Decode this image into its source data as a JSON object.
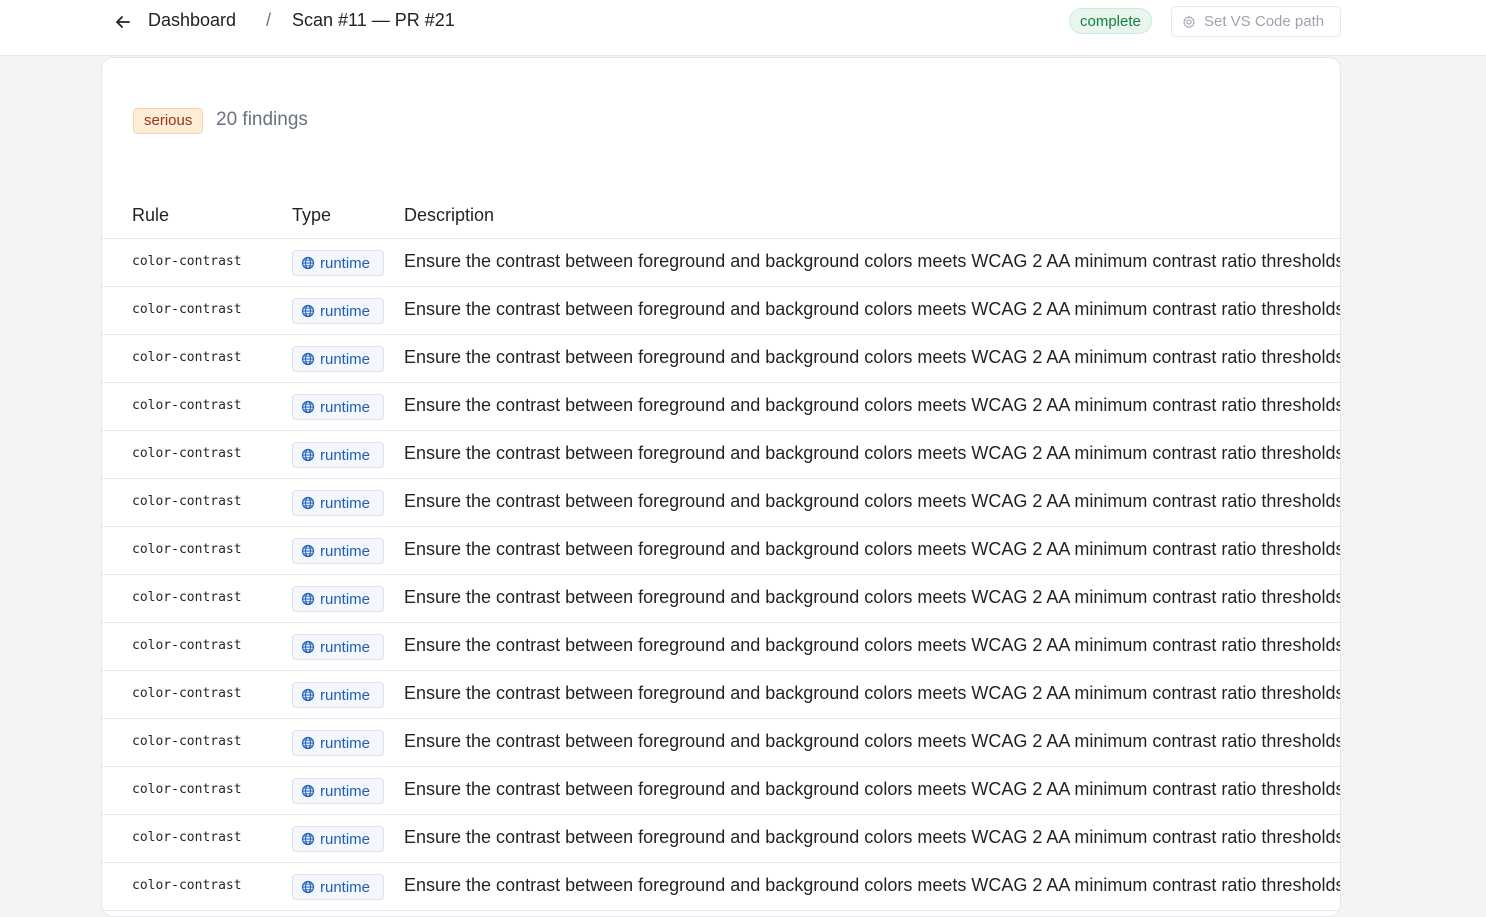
{
  "header": {
    "back_icon": "arrow-left-icon",
    "breadcrumb_root": "Dashboard",
    "breadcrumb_separator": "/",
    "breadcrumb_current": "Scan #11 — PR #21",
    "status": "complete",
    "status_color": "#15803d",
    "vscode_icon": "gear-icon",
    "vscode_label": "Set VS Code path"
  },
  "summary": {
    "severity": "serious",
    "severity_color": "#9a3412",
    "findings_text": "20 findings"
  },
  "table": {
    "columns": [
      "Rule",
      "Type",
      "Description"
    ],
    "type_icon": "globe-icon",
    "rows": [
      {
        "rule": "color-contrast",
        "type": "runtime",
        "description": "Ensure the contrast between foreground and background colors meets WCAG 2 AA minimum contrast ratio thresholds"
      },
      {
        "rule": "color-contrast",
        "type": "runtime",
        "description": "Ensure the contrast between foreground and background colors meets WCAG 2 AA minimum contrast ratio thresholds"
      },
      {
        "rule": "color-contrast",
        "type": "runtime",
        "description": "Ensure the contrast between foreground and background colors meets WCAG 2 AA minimum contrast ratio thresholds"
      },
      {
        "rule": "color-contrast",
        "type": "runtime",
        "description": "Ensure the contrast between foreground and background colors meets WCAG 2 AA minimum contrast ratio thresholds"
      },
      {
        "rule": "color-contrast",
        "type": "runtime",
        "description": "Ensure the contrast between foreground and background colors meets WCAG 2 AA minimum contrast ratio thresholds"
      },
      {
        "rule": "color-contrast",
        "type": "runtime",
        "description": "Ensure the contrast between foreground and background colors meets WCAG 2 AA minimum contrast ratio thresholds"
      },
      {
        "rule": "color-contrast",
        "type": "runtime",
        "description": "Ensure the contrast between foreground and background colors meets WCAG 2 AA minimum contrast ratio thresholds"
      },
      {
        "rule": "color-contrast",
        "type": "runtime",
        "description": "Ensure the contrast between foreground and background colors meets WCAG 2 AA minimum contrast ratio thresholds"
      },
      {
        "rule": "color-contrast",
        "type": "runtime",
        "description": "Ensure the contrast between foreground and background colors meets WCAG 2 AA minimum contrast ratio thresholds"
      },
      {
        "rule": "color-contrast",
        "type": "runtime",
        "description": "Ensure the contrast between foreground and background colors meets WCAG 2 AA minimum contrast ratio thresholds"
      },
      {
        "rule": "color-contrast",
        "type": "runtime",
        "description": "Ensure the contrast between foreground and background colors meets WCAG 2 AA minimum contrast ratio thresholds"
      },
      {
        "rule": "color-contrast",
        "type": "runtime",
        "description": "Ensure the contrast between foreground and background colors meets WCAG 2 AA minimum contrast ratio thresholds"
      },
      {
        "rule": "color-contrast",
        "type": "runtime",
        "description": "Ensure the contrast between foreground and background colors meets WCAG 2 AA minimum contrast ratio thresholds"
      },
      {
        "rule": "color-contrast",
        "type": "runtime",
        "description": "Ensure the contrast between foreground and background colors meets WCAG 2 AA minimum contrast ratio thresholds"
      }
    ]
  }
}
